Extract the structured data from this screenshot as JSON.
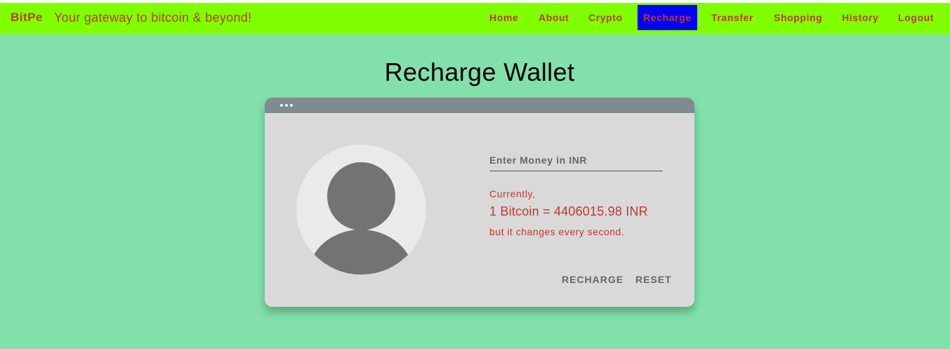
{
  "navbar": {
    "brand": "BitPe",
    "tagline": "Your gateway to bitcoin & beyond!",
    "links": [
      "Home",
      "About",
      "Crypto",
      "Recharge",
      "Transfer",
      "Shopping",
      "History",
      "Logout"
    ],
    "active_link": "Recharge"
  },
  "page": {
    "title": "Recharge Wallet"
  },
  "card": {
    "window_dots_icon": "three-dots",
    "avatar_icon": "user-avatar",
    "input_placeholder": "Enter Money in INR",
    "rate_line_1": "Currently,",
    "rate_line_2": "1 Bitcoin = 4406015.98 INR",
    "rate_line_3": "but it changes every second.",
    "recharge_label": "RECHARGE",
    "reset_label": "RESET"
  },
  "colors": {
    "background": "#82e0aa",
    "navbar": "#7fff00",
    "accent_text": "#c0392b",
    "active_link_bg": "#0000ff",
    "card": "#d9d9d9",
    "card_bar": "#7f8c8d"
  }
}
